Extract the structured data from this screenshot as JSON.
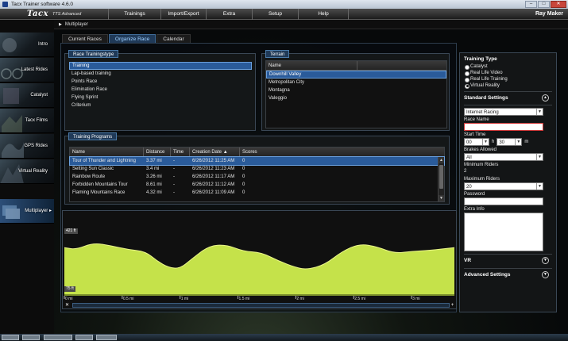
{
  "window": {
    "title": "Tacx Trainer software 4.6.0"
  },
  "app": {
    "logo": "Tacx",
    "edition": "TTS Advanced",
    "user": "Ray Maker"
  },
  "menu": [
    "Trainings",
    "Import/Export",
    "Extra",
    "Setup",
    "Help"
  ],
  "sidebar": {
    "items": [
      {
        "label": "Intro",
        "icon": "intro-icon"
      },
      {
        "label": "Latest Rides",
        "icon": "bike-icon"
      },
      {
        "label": "Catalyst",
        "icon": "catalyst-icon"
      },
      {
        "label": "Tacx Films",
        "icon": "film-icon"
      },
      {
        "label": "GPS Rides",
        "icon": "gps-icon"
      },
      {
        "label": "Virtual Reality",
        "icon": "vr-icon"
      },
      {
        "label": "Multiplayer",
        "icon": "multiplayer-icon",
        "active": true
      }
    ]
  },
  "breadcrumb": "Multiplayer",
  "tabs": [
    {
      "label": "Current Races",
      "active": false
    },
    {
      "label": "Organize Race",
      "active": true
    },
    {
      "label": "Calendar",
      "active": false
    }
  ],
  "race_trainingstype": {
    "title": "Race Trainingstype",
    "items": [
      "Training",
      "Lap-based training",
      "Points Race",
      "Elimination Race",
      "Flying Sprint",
      "Criterium"
    ],
    "selected": "Training"
  },
  "terrain": {
    "title": "Terrain",
    "header": "Name",
    "items": [
      "Downhill Valley",
      "Metropolitan City",
      "Montagna",
      "Valeggio"
    ],
    "selected": "Downhill Valley"
  },
  "training_programs": {
    "title": "Training Programs",
    "columns": [
      "Name",
      "Distance",
      "Time",
      "Creation Date",
      "Scores"
    ],
    "rows": [
      [
        "Tour of Thunder and Lightning",
        "3.37 mi",
        "-",
        "6/26/2012 11:25 AM",
        "0"
      ],
      [
        "Setting Sun Classic",
        "3.4 mi",
        "-",
        "6/26/2012 11:23 AM",
        "0"
      ],
      [
        "Rainbow Route",
        "3.26 mi",
        "-",
        "6/26/2012 11:17 AM",
        "0"
      ],
      [
        "Forbidden Mountains Tour",
        "8.61 mi",
        "-",
        "6/26/2012 11:12 AM",
        "0"
      ],
      [
        "Flaming Mountains Race",
        "4.32 mi",
        "-",
        "6/26/2012 11:09 AM",
        "0"
      ]
    ],
    "selected_row": 0
  },
  "elevation": {
    "max_label": "421 ft",
    "min_label": "75 ft",
    "x_ticks": [
      "0 mi",
      "0.5 mi",
      "1 mi",
      "1.5 mi",
      "2 mi",
      "2.5 mi",
      "3 mi"
    ]
  },
  "chart_data": {
    "type": "area",
    "title": "",
    "xlabel": "",
    "ylabel": "",
    "ylim": [
      75,
      421
    ],
    "xlim": [
      0,
      3.37
    ],
    "x": [
      0,
      0.1,
      0.25,
      0.4,
      0.55,
      0.7,
      0.8,
      0.9,
      1.0,
      1.1,
      1.25,
      1.4,
      1.55,
      1.7,
      1.85,
      2.0,
      2.1,
      2.25,
      2.4,
      2.55,
      2.7,
      2.85,
      3.0,
      3.15,
      3.37
    ],
    "series": [
      {
        "values": [
          320,
          310,
          345,
          330,
          310,
          300,
          250,
          215,
          210,
          260,
          330,
          335,
          300,
          295,
          250,
          215,
          205,
          230,
          300,
          340,
          325,
          290,
          300,
          305,
          320
        ]
      }
    ],
    "grid": false,
    "colors": {
      "fill": "#c5e24a",
      "line": "#eaf58a"
    }
  },
  "settings": {
    "training_type": {
      "label": "Training Type",
      "options": [
        "Catalyst",
        "Real Life Video",
        "Real Life Training",
        "Virtual Reality"
      ],
      "selected": "Virtual Reality"
    },
    "standard": {
      "label": "Standard Settings",
      "race_type": "Internet Racing",
      "race_name_label": "Race Name",
      "race_name_value": "",
      "start_time_label": "Start Time",
      "start_hour": "00",
      "start_min": "30",
      "h_label": "h",
      "m_label": "m",
      "brakes_label": "Brakes Allowed",
      "brakes_value": "All",
      "min_riders_label": "Minimum Riders",
      "min_riders_value": "2",
      "max_riders_label": "Maximum Riders",
      "max_riders_value": "20",
      "password_label": "Password",
      "extra_info_label": "Extra Info"
    },
    "vr_label": "VR",
    "advanced_label": "Advanced Settings"
  },
  "colors": {
    "accent": "#2a5b9a",
    "tab_active": "#203a58",
    "elevation_fill": "#c5e24a"
  }
}
